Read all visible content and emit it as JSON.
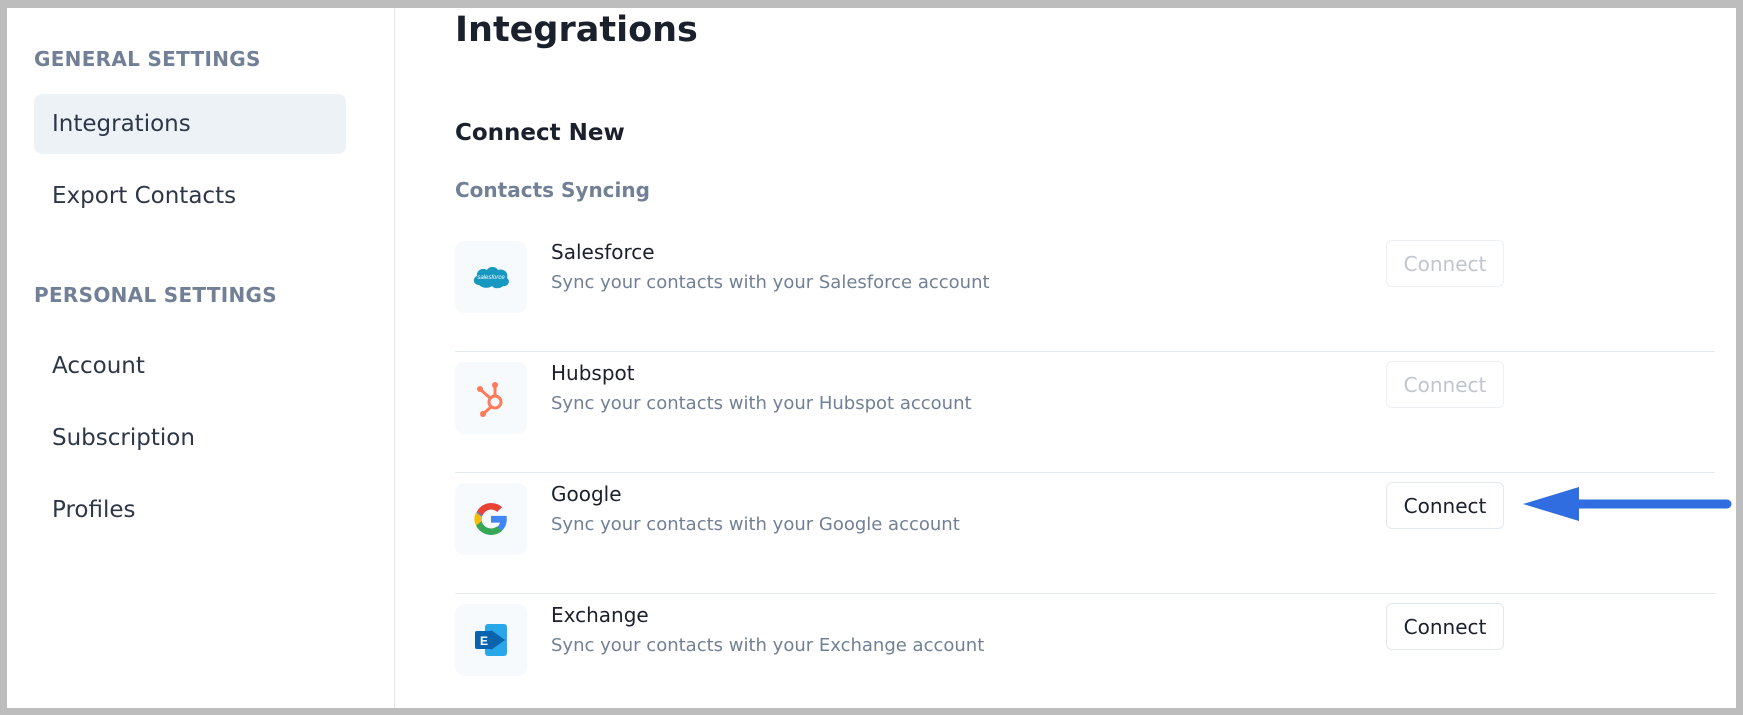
{
  "sidebar": {
    "general_label": "GENERAL SETTINGS",
    "general_items": [
      {
        "label": "Integrations",
        "active": true
      },
      {
        "label": "Export Contacts",
        "active": false
      }
    ],
    "personal_label": "PERSONAL SETTINGS",
    "personal_items": [
      {
        "label": "Account"
      },
      {
        "label": "Subscription"
      },
      {
        "label": "Profiles"
      }
    ]
  },
  "main": {
    "title": "Integrations",
    "connect_new": "Connect New",
    "subsection": "Contacts Syncing",
    "integrations": [
      {
        "name": "Salesforce",
        "description": "Sync your contacts with your Salesforce account",
        "button": "Connect",
        "enabled": false,
        "icon": "salesforce-icon",
        "logo_text": "salesforce"
      },
      {
        "name": "Hubspot",
        "description": "Sync your contacts with your Hubspot account",
        "button": "Connect",
        "enabled": false,
        "icon": "hubspot-icon"
      },
      {
        "name": "Google",
        "description": "Sync your contacts with your Google account",
        "button": "Connect",
        "enabled": true,
        "icon": "google-icon"
      },
      {
        "name": "Exchange",
        "description": "Sync your contacts with your Exchange account",
        "button": "Connect",
        "enabled": true,
        "icon": "exchange-icon",
        "logo_text": "E"
      }
    ]
  },
  "annotation": {
    "icon": "arrow-left-icon",
    "color": "#2f6de1"
  },
  "colors": {
    "sidebar_active_bg": "#edf2f7",
    "muted_text": "#718096",
    "salesforce": "#1798c1",
    "hubspot": "#ff7a59",
    "exchange": "#0a64ad"
  }
}
